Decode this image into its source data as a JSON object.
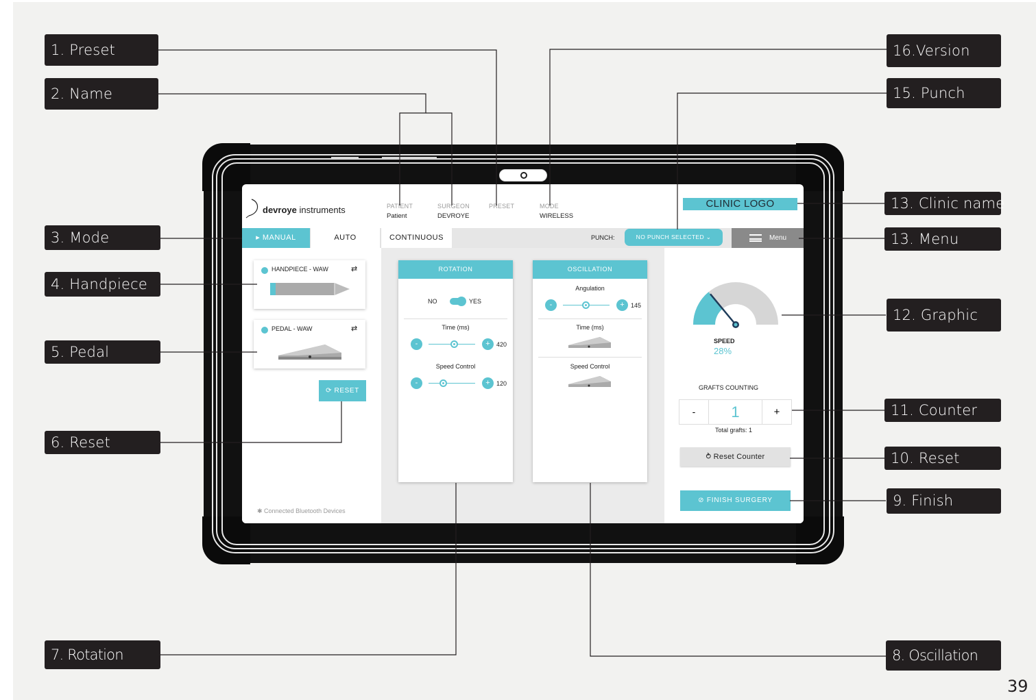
{
  "callouts": {
    "preset": "1. Preset",
    "name": "2. Name",
    "mode": "3. Mode",
    "handpiece": "4. Handpiece",
    "pedal": "5. Pedal",
    "reset": "6. Reset",
    "rotation": "7. Rotation",
    "oscillation": "8. Oscillation",
    "finish": "9. Finish",
    "reset_counter": "10. Reset",
    "counter": "11. Counter",
    "graphic": "12. Graphic",
    "menu": "13. Menu",
    "clinic_name": "13. Clinic name",
    "punch": "15. Punch",
    "version": "16.Version"
  },
  "page_number": "39",
  "app": {
    "brand_name": "devroye",
    "brand_suffix": "instruments",
    "clinic_logo": "CLINIC LOGO",
    "header": {
      "patient_label": "PATIENT",
      "patient_value": "Patient",
      "surgeon_label": "SURGEON",
      "surgeon_value": "DEVROYE",
      "preset_label": "PRESET",
      "mode_label": "MODE",
      "mode_value": "WIRELESS"
    },
    "tabs": {
      "manual": "▸ MANUAL",
      "auto": "AUTO",
      "continuous": "CONTINUOUS"
    },
    "punch_label": "PUNCH:",
    "punch_select": "NO PUNCH SELECTED ⌄",
    "menu_label": "Menu",
    "handpiece_card": "HANDPIECE - WAW",
    "pedal_card": "PEDAL - WAW",
    "swap_glyph": "⇄",
    "reset_button": "⟳  RESET",
    "bluetooth_footer": "✱ Connected Bluetooth Devices",
    "rotation": {
      "title": "ROTATION",
      "toggle_no": "NO",
      "toggle_yes": "YES",
      "time_label": "Time (ms)",
      "time_value": "420",
      "speed_label": "Speed Control",
      "speed_value": "120"
    },
    "oscillation": {
      "title": "OSCILLATION",
      "angulation_label": "Angulation",
      "angulation_value": "145",
      "time_label": "Time (ms)",
      "speed_label": "Speed Control"
    },
    "minus_glyph": "-",
    "plus_glyph": "+",
    "speed_label": "SPEED",
    "speed_value": "28%",
    "speed_fraction": 0.28,
    "grafts_title": "GRAFTS COUNTING",
    "counter_minus": "-",
    "counter_value": "1",
    "counter_plus": "+",
    "total_grafts": "Total grafts: 1",
    "reset_counter": "⥁ Reset Counter",
    "finish_surgery": "⊘  FINISH SURGERY"
  },
  "colors": {
    "accent": "#5cc4d1",
    "callout_bg": "#231f20",
    "page_bg": "#f2f2f0"
  }
}
